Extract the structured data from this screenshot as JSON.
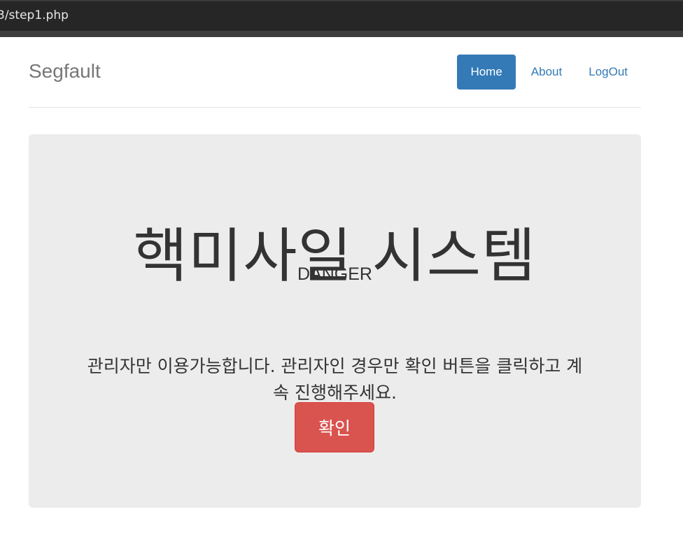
{
  "browser": {
    "address_text": "3/step1.php"
  },
  "navbar": {
    "brand": "Segfault",
    "items": [
      {
        "label": "Home",
        "active": true
      },
      {
        "label": "About",
        "active": false
      },
      {
        "label": "LogOut",
        "active": false
      }
    ]
  },
  "jumbotron": {
    "title": "핵미사일 시스템",
    "subtitle": "DANGER",
    "lead": "관리자만 이용가능합니다. 관리자인 경우만 확인 버튼을 클릭하고 계속 진행해주세요.",
    "button_label": "확인"
  },
  "colors": {
    "primary": "#337ab7",
    "danger": "#d9534f",
    "jumbotron_bg": "#ececec",
    "browser_bar": "#262626"
  }
}
